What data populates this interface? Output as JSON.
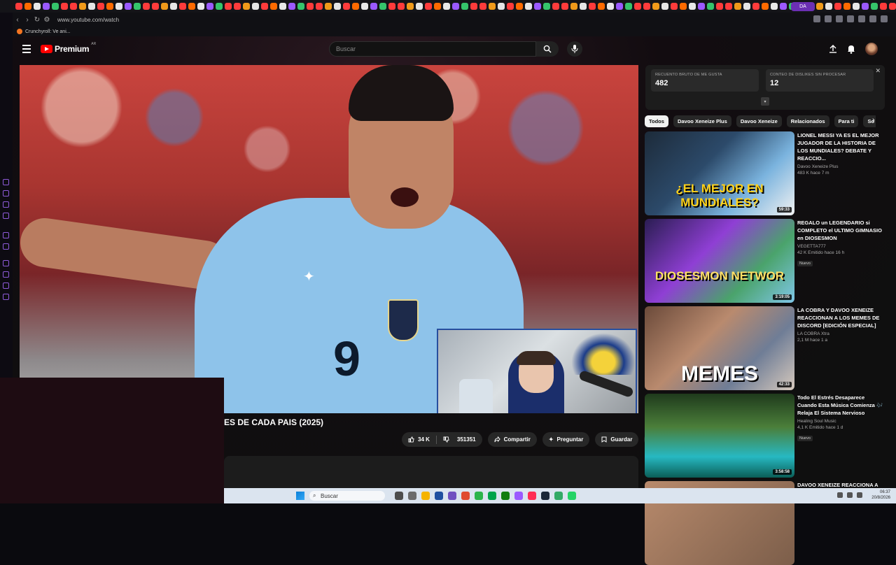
{
  "browser": {
    "url": "www.youtube.com/watch",
    "bookmark_label": "Crunchyroll: Ve ani...",
    "profile_label": "DA",
    "ai_label": "AI"
  },
  "header": {
    "logo_text": "Premium",
    "logo_country": "AR",
    "search_placeholder": "Buscar"
  },
  "video": {
    "title": "ES DE CADA PAIS (2025)",
    "shirt_number": "9",
    "likes_label": "34 K",
    "dislikes_label": "351351",
    "share_label": "Compartir",
    "ask_label": "Preguntar",
    "save_label": "Guardar"
  },
  "dislike_panel": {
    "likes_title": "RECUENTO BRUTO DE ME GUSTA",
    "likes_value": "482",
    "dislikes_title": "CONTEO DE DISLIKES SIN PROCESAR",
    "dislikes_value": "12"
  },
  "chips": [
    "Todos",
    "Davoo Xeneize Plus",
    "Davoo Xeneize",
    "Relacionados",
    "Para ti",
    "So"
  ],
  "recommendations": [
    {
      "title": "LIONEL MESSI YA ES EL MEJOR JUGADOR DE LA HISTORIA DE LOS MUNDIALES? DEBATE Y REACCIO...",
      "channel": "Davoo Xeneize Plus",
      "meta": "483 K  hace 7 m",
      "duration": "59:33",
      "thumb_text": "¿EL MEJOR EN MUNDIALES?",
      "badge": ""
    },
    {
      "title": "REGALO un LEGENDARIO si COMPLETO el ULTIMO GIMNASIO en DIOSESMON",
      "channel": "VEGETTA777",
      "meta": "42 K  Emitido hace 16 h",
      "duration": "3:19:05",
      "thumb_text": "DIOSESMON NETWOR",
      "badge": "Nuevo"
    },
    {
      "title": "LA COBRA Y DAVOO XENEIZE REACCIONAN A LOS MEMES DE DISCORD [EDICIÓN ESPECIAL]",
      "channel": "LA COBRA Xtra",
      "meta": "2,1 M  hace 1 a",
      "duration": "42:33",
      "thumb_text": "MEMES",
      "badge": ""
    },
    {
      "title": "Todo El Estrés Desaparece Cuando Esta Música Comienza 🎶 Relaja El Sistema Nervioso",
      "channel": "Healing Soul Music",
      "meta": "4,1 K  Emitido hace 1 d",
      "duration": "3:58:58",
      "thumb_text": "",
      "badge": "Nuevo"
    },
    {
      "title": "DAVOO XENEIZE REACCIONA A LA",
      "channel": "",
      "meta": "",
      "duration": "",
      "thumb_text": "",
      "badge": ""
    }
  ],
  "taskbar": {
    "search_label": "Buscar",
    "time": "06:37",
    "date": "20/8/2026"
  },
  "colors": {
    "accent_red": "#ff0000",
    "profile_purple": "#6b2fb3",
    "cam_border": "#274e9e"
  }
}
